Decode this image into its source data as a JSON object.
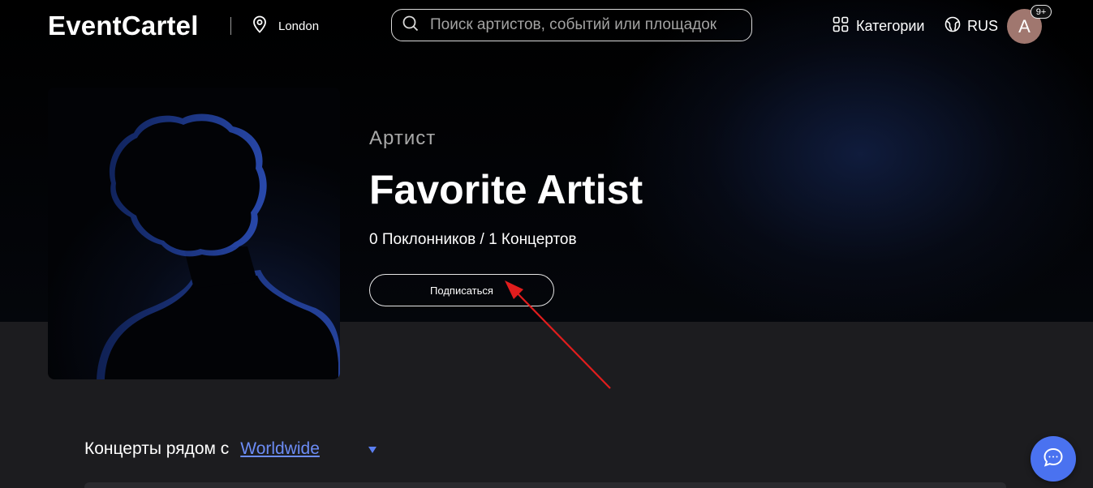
{
  "header": {
    "logo": "EventCartel",
    "location": "London",
    "search_placeholder": "Поиск артистов, событий или площадок",
    "categories_label": "Категории",
    "language_label": "RUS",
    "avatar_initial": "A",
    "notification_badge": "9+"
  },
  "artist": {
    "type_label": "Артист",
    "name": "Favorite Artist",
    "stats": "0 Поклонников / 1 Концертов",
    "subscribe_label": "Подписаться"
  },
  "concerts": {
    "heading_prefix": "Концерты рядом с",
    "location_link": "Worldwide"
  },
  "colors": {
    "accent": "#4a72f0",
    "link": "#6c8cf5",
    "annotation_arrow": "#e11d1d",
    "avatar_bg": "#a0776f"
  },
  "icons": {
    "location": "map-pin-icon",
    "search": "search-icon",
    "categories": "grid-icon",
    "language": "globe-icon",
    "chat": "chat-bubble-icon",
    "dropdown": "triangle-down-icon"
  }
}
